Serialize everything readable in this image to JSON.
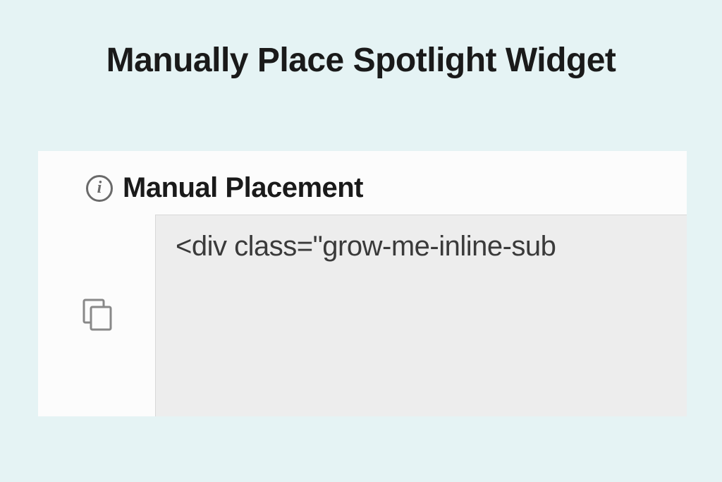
{
  "page": {
    "title": "Manually Place Spotlight Widget"
  },
  "section": {
    "title": "Manual Placement"
  },
  "code": {
    "snippet": "<div class=\"grow-me-inline-sub"
  }
}
